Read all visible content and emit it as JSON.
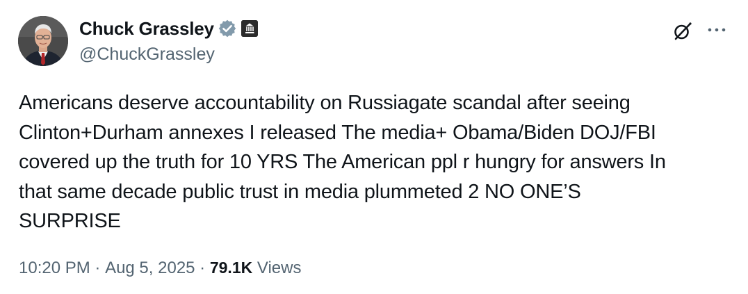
{
  "author": {
    "display_name": "Chuck Grassley",
    "handle": "@ChuckGrassley",
    "verified_badge_icon": "verified-badge-icon",
    "affiliation_badge_icon": "government-building-icon",
    "verified_color": "#829aab"
  },
  "header_actions": {
    "grok_icon": "grok-icon",
    "more_icon": "more-dots-icon"
  },
  "tweet": {
    "text": "Americans deserve accountability on Russiagate scandal after seeing\nClinton+Durham annexes I released The media+ Obama/Biden DOJ/FBI\ncovered up the truth for 10 YRS The American ppl r hungry for answers In\nthat same decade public trust in media plummeted 2 NO ONE’S\nSURPRISE"
  },
  "meta": {
    "time": "10:20 PM",
    "separator": " · ",
    "date": "Aug 5, 2025",
    "views_count": "79.1K",
    "views_label": " Views"
  },
  "colors": {
    "text_primary": "#0f1419",
    "text_secondary": "#536471",
    "background": "#ffffff"
  }
}
